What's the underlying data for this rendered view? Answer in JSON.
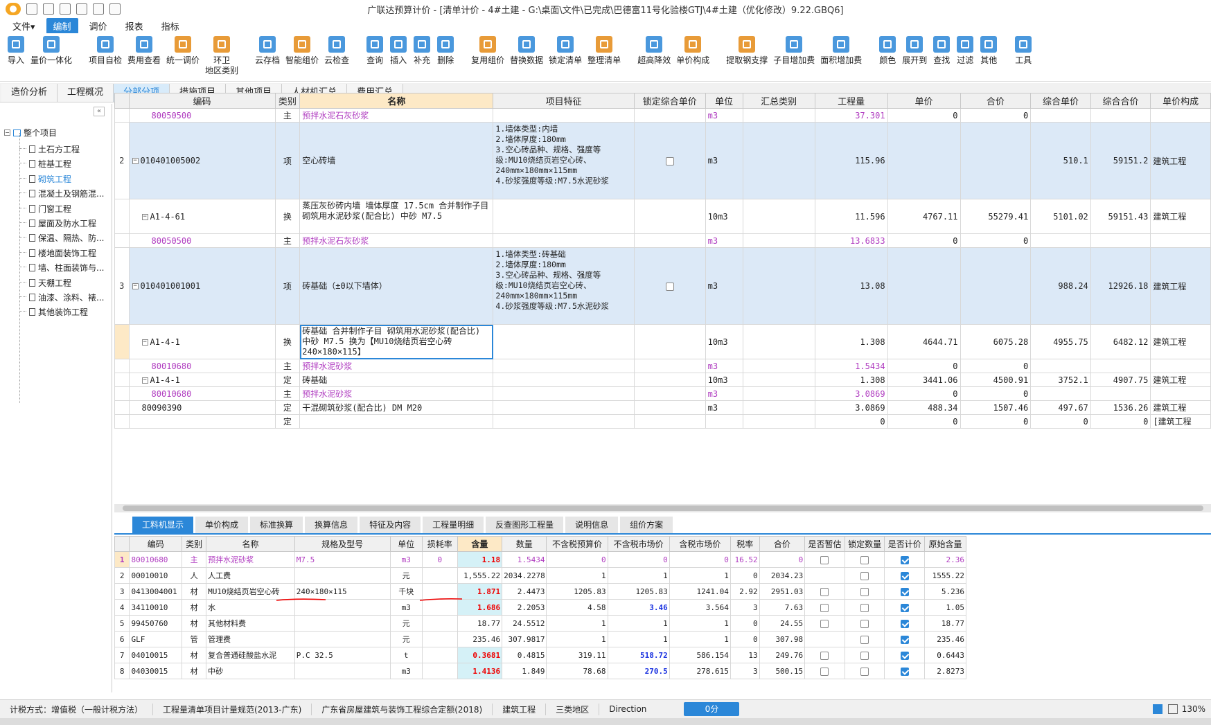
{
  "window": {
    "title": "广联达预算计价 - [清单计价 - 4#土建 - G:\\桌面\\文件\\已完成\\巴德富11号化验楼GTJ\\4#土建（优化修改）9.22.GBQ6]"
  },
  "menu": [
    "文件▾",
    "编制",
    "调价",
    "报表",
    "指标"
  ],
  "toolbar": [
    {
      "label": "导入",
      "icon": "import-icon",
      "color": "#2b87d8"
    },
    {
      "label": "量价一体化",
      "icon": "integration-icon",
      "color": "#2b87d8"
    },
    {
      "label": "项目自检",
      "icon": "self-check-icon",
      "color": "#2b87d8"
    },
    {
      "label": "费用查看",
      "icon": "fee-view-icon",
      "color": "#2b87d8"
    },
    {
      "label": "统一调价",
      "icon": "adjust-price-icon",
      "color": "#e58a16"
    },
    {
      "label": "环卫\n地区类别",
      "icon": "sanitation-icon",
      "color": "#e58a16"
    },
    {
      "label": "云存档",
      "icon": "cloud-save-icon",
      "color": "#2b87d8"
    },
    {
      "label": "智能组价",
      "icon": "smart-price-icon",
      "color": "#e58a16"
    },
    {
      "label": "云检查",
      "icon": "cloud-check-icon",
      "color": "#2b87d8"
    },
    {
      "label": "查询",
      "icon": "query-icon",
      "color": "#2b87d8"
    },
    {
      "label": "插入",
      "icon": "insert-icon",
      "color": "#2b87d8"
    },
    {
      "label": "补充",
      "icon": "supplement-icon",
      "color": "#2b87d8"
    },
    {
      "label": "删除",
      "icon": "delete-icon",
      "color": "#2b87d8"
    },
    {
      "label": "复用组价",
      "icon": "reuse-icon",
      "color": "#e58a16"
    },
    {
      "label": "替换数据",
      "icon": "replace-icon",
      "color": "#2b87d8"
    },
    {
      "label": "锁定清单",
      "icon": "lock-icon",
      "color": "#2b87d8"
    },
    {
      "label": "整理清单",
      "icon": "organize-icon",
      "color": "#e58a16"
    },
    {
      "label": "超高降效",
      "icon": "height-icon",
      "color": "#2b87d8"
    },
    {
      "label": "单价构成",
      "icon": "unit-price-icon",
      "color": "#e58a16"
    },
    {
      "label": "提取钢支撑",
      "icon": "steel-support-icon",
      "color": "#e58a16"
    },
    {
      "label": "子目增加费",
      "icon": "item-fee-icon",
      "color": "#2b87d8"
    },
    {
      "label": "面积增加费",
      "icon": "area-fee-icon",
      "color": "#2b87d8"
    },
    {
      "label": "颜色",
      "icon": "color-icon",
      "color": "#2b87d8"
    },
    {
      "label": "展开到",
      "icon": "expand-icon",
      "color": "#2b87d8"
    },
    {
      "label": "查找",
      "icon": "find-icon",
      "color": "#2b87d8"
    },
    {
      "label": "过滤",
      "icon": "filter-icon",
      "color": "#2b87d8"
    },
    {
      "label": "其他",
      "icon": "other-icon",
      "color": "#2b87d8"
    },
    {
      "label": "工具",
      "icon": "tools-icon",
      "color": "#2b87d8"
    }
  ],
  "tabs": [
    "造价分析",
    "工程概况",
    "分部分项",
    "措施项目",
    "其他项目",
    "人材机汇总",
    "费用汇总"
  ],
  "tree": {
    "root": "整个项目",
    "items": [
      "土石方工程",
      "桩基工程",
      "砌筑工程",
      "混凝土及钢筋混...",
      "门窗工程",
      "屋面及防水工程",
      "保温、隔热、防...",
      "楼地面装饰工程",
      "墙、柱面装饰与...",
      "天棚工程",
      "油漆、涂料、裱...",
      "其他装饰工程"
    ]
  },
  "grid": {
    "headers": [
      "",
      "编码",
      "类别",
      "名称",
      "项目特征",
      "锁定综合单价",
      "单位",
      "汇总类别",
      "工程量",
      "单价",
      "合价",
      "综合单价",
      "综合合价",
      "单价构成"
    ],
    "rows": [
      {
        "rn": "",
        "code": "80050500",
        "type": "主",
        "name": "预拌水泥石灰砂浆",
        "feature": "",
        "lock": "",
        "unit": "m3",
        "sum": "",
        "qty": "37.301",
        "price": "0",
        "total": "0",
        "cprice": "",
        "ctotal": "",
        "comp": "",
        "kind": "zhu",
        "indent": 2
      },
      {
        "rn": "2",
        "code": "010401005002",
        "type": "项",
        "name": "空心砖墙",
        "feature": "1.墙体类型:内墙\n2.墙体厚度:180mm\n3.空心砖品种、规格、强度等级:MU10烧结页岩空心砖、240mm×180mm×115mm\n4.砂浆强度等级:M7.5水泥砂浆",
        "lock": "box",
        "unit": "m3",
        "sum": "",
        "qty": "115.96",
        "price": "",
        "total": "",
        "cprice": "510.1",
        "ctotal": "59151.2",
        "comp": "建筑工程",
        "kind": "xiang",
        "indent": 0,
        "toggle": "−"
      },
      {
        "rn": "",
        "code": "A1-4-61",
        "type": "换",
        "name": "蒸压灰砂砖内墙 墙体厚度 17.5cm  合并制作子目 砌筑用水泥砂浆(配合比) 中砂 M7.5",
        "feature": "",
        "lock": "",
        "unit": "10m3",
        "sum": "",
        "qty": "11.596",
        "price": "4767.11",
        "total": "55279.41",
        "cprice": "5101.02",
        "ctotal": "59151.43",
        "comp": "建筑工程",
        "kind": "de",
        "indent": 1,
        "toggle": "−"
      },
      {
        "rn": "",
        "code": "80050500",
        "type": "主",
        "name": "预拌水泥石灰砂浆",
        "feature": "",
        "lock": "",
        "unit": "m3",
        "sum": "",
        "qty": "13.6833",
        "price": "0",
        "total": "0",
        "cprice": "",
        "ctotal": "",
        "comp": "",
        "kind": "zhu",
        "indent": 2
      },
      {
        "rn": "3",
        "code": "010401001001",
        "type": "项",
        "name": "砖基础（±0以下墙体）",
        "feature": "1.墙体类型:砖基础\n2.墙体厚度:180mm\n3.空心砖品种、规格、强度等级:MU10烧结页岩空心砖、240mm×180mm×115mm\n4.砂浆强度等级:M7.5水泥砂浆",
        "lock": "box",
        "unit": "m3",
        "sum": "",
        "qty": "13.08",
        "price": "",
        "total": "",
        "cprice": "988.24",
        "ctotal": "12926.18",
        "comp": "建筑工程",
        "kind": "xiang",
        "indent": 0,
        "toggle": "−"
      },
      {
        "rn": "",
        "code": "A1-4-1",
        "type": "换",
        "name": "砖基础  合并制作子目 砌筑用水泥砂浆(配合比) 中砂 M7.5  换为【MU10烧结页岩空心砖240×180×115】",
        "feature": "",
        "lock": "",
        "unit": "10m3",
        "sum": "",
        "qty": "1.308",
        "price": "4644.71",
        "total": "6075.28",
        "cprice": "4955.75",
        "ctotal": "6482.12",
        "comp": "建筑工程",
        "kind": "de-sel",
        "indent": 1,
        "toggle": "−"
      },
      {
        "rn": "",
        "code": "80010680",
        "type": "主",
        "name": "预拌水泥砂浆",
        "feature": "",
        "lock": "",
        "unit": "m3",
        "sum": "",
        "qty": "1.5434",
        "price": "0",
        "total": "0",
        "cprice": "",
        "ctotal": "",
        "comp": "",
        "kind": "zhu",
        "indent": 2
      },
      {
        "rn": "",
        "code": "A1-4-1",
        "type": "定",
        "name": "砖基础",
        "feature": "",
        "lock": "",
        "unit": "10m3",
        "sum": "",
        "qty": "1.308",
        "price": "3441.06",
        "total": "4500.91",
        "cprice": "3752.1",
        "ctotal": "4907.75",
        "comp": "建筑工程",
        "kind": "de",
        "indent": 1,
        "toggle": "−"
      },
      {
        "rn": "",
        "code": "80010680",
        "type": "主",
        "name": "预拌水泥砂浆",
        "feature": "",
        "lock": "",
        "unit": "m3",
        "sum": "",
        "qty": "3.0869",
        "price": "0",
        "total": "0",
        "cprice": "",
        "ctotal": "",
        "comp": "",
        "kind": "zhu",
        "indent": 2
      },
      {
        "rn": "",
        "code": "80090390",
        "type": "定",
        "name": "干混砌筑砂浆(配合比) DM M20",
        "feature": "",
        "lock": "",
        "unit": "m3",
        "sum": "",
        "qty": "3.0869",
        "price": "488.34",
        "total": "1507.46",
        "cprice": "497.67",
        "ctotal": "1536.26",
        "comp": "建筑工程",
        "kind": "de",
        "indent": 1
      },
      {
        "rn": "",
        "code": "",
        "type": "定",
        "name": "",
        "feature": "",
        "lock": "",
        "unit": "",
        "sum": "",
        "qty": "0",
        "price": "0",
        "total": "0",
        "cprice": "0",
        "ctotal": "0",
        "comp": "[建筑工程",
        "kind": "de",
        "indent": 1
      }
    ]
  },
  "bottom_tabs": [
    "工料机显示",
    "单价构成",
    "标准换算",
    "换算信息",
    "特征及内容",
    "工程量明细",
    "反查图形工程量",
    "说明信息",
    "组价方案"
  ],
  "sub": {
    "headers": [
      "",
      "编码",
      "类别",
      "名称",
      "规格及型号",
      "单位",
      "损耗率",
      "含量",
      "数量",
      "不含税预算价",
      "不含税市场价",
      "含税市场价",
      "税率",
      "合价",
      "是否暂估",
      "锁定数量",
      "是否计价",
      "原始含量"
    ],
    "rows": [
      {
        "rn": "1",
        "code": "80010680",
        "type": "主",
        "name": "预拌水泥砂浆",
        "spec": "M7.5",
        "unit": "m3",
        "loss": "0",
        "qty": "1.18",
        "count": "1.5434",
        "p1": "0",
        "p2": "0",
        "p3": "0",
        "tax": "16.52",
        "total": "0",
        "est": "box",
        "lockq": "box",
        "calc": "on",
        "orig": "2.36",
        "kind": "zhu",
        "red": true
      },
      {
        "rn": "2",
        "code": "00010010",
        "type": "人",
        "name": "人工费",
        "spec": "",
        "unit": "元",
        "loss": "",
        "qty": "1,555.22",
        "count": "2034.2278",
        "p1": "1",
        "p2": "1",
        "p3": "1",
        "tax": "0",
        "total": "2034.23",
        "est": "",
        "lockq": "box",
        "calc": "on",
        "orig": "1555.22",
        "kind": "",
        "red": false
      },
      {
        "rn": "3",
        "code": "0413004001",
        "type": "材",
        "name": "MU10烧结页岩空心砖",
        "spec": "240×180×115",
        "unit": "千块",
        "loss": "",
        "qty": "1.871",
        "count": "2.4473",
        "p1": "1205.83",
        "p2": "1205.83",
        "p3": "1241.04",
        "tax": "2.92",
        "total": "2951.03",
        "est": "box",
        "lockq": "box",
        "calc": "on",
        "orig": "5.236",
        "kind": "",
        "red": true
      },
      {
        "rn": "4",
        "code": "34110010",
        "type": "材",
        "name": "水",
        "spec": "",
        "unit": "m3",
        "loss": "",
        "qty": "1.686",
        "count": "2.2053",
        "p1": "4.58",
        "p2": "3.46",
        "p3": "3.564",
        "tax": "3",
        "total": "7.63",
        "est": "box",
        "lockq": "box",
        "calc": "on",
        "orig": "1.05",
        "kind": "",
        "red": true,
        "blue": true
      },
      {
        "rn": "5",
        "code": "99450760",
        "type": "材",
        "name": "其他材料费",
        "spec": "",
        "unit": "元",
        "loss": "",
        "qty": "18.77",
        "count": "24.5512",
        "p1": "1",
        "p2": "1",
        "p3": "1",
        "tax": "0",
        "total": "24.55",
        "est": "box",
        "lockq": "box",
        "calc": "on",
        "orig": "18.77",
        "kind": "",
        "red": false
      },
      {
        "rn": "6",
        "code": "GLF",
        "type": "管",
        "name": "管理费",
        "spec": "",
        "unit": "元",
        "loss": "",
        "qty": "235.46",
        "count": "307.9817",
        "p1": "1",
        "p2": "1",
        "p3": "1",
        "tax": "0",
        "total": "307.98",
        "est": "",
        "lockq": "box",
        "calc": "on",
        "orig": "235.46",
        "kind": "",
        "red": false
      },
      {
        "rn": "7",
        "code": "04010015",
        "type": "材",
        "name": "复合普通硅酸盐水泥",
        "spec": "P.C 32.5",
        "unit": "t",
        "loss": "",
        "qty": "0.3681",
        "count": "0.4815",
        "p1": "319.11",
        "p2": "518.72",
        "p3": "586.154",
        "tax": "13",
        "total": "249.76",
        "est": "box",
        "lockq": "box",
        "calc": "on",
        "orig": "0.6443",
        "kind": "",
        "red": true,
        "blue": true
      },
      {
        "rn": "8",
        "code": "04030015",
        "type": "材",
        "name": "中砂",
        "spec": "",
        "unit": "m3",
        "loss": "",
        "qty": "1.4136",
        "count": "1.849",
        "p1": "78.68",
        "p2": "270.5",
        "p3": "278.615",
        "tax": "3",
        "total": "500.15",
        "est": "box",
        "lockq": "box",
        "calc": "on",
        "orig": "2.8273",
        "kind": "",
        "red": true,
        "blue": true
      }
    ]
  },
  "status": {
    "tax_method": "计税方式：增值税（一般计税方法）",
    "spec": "工程量清单项目计量规范(2013-广东)",
    "quota": "广东省房屋建筑与装饰工程综合定额(2018)",
    "major": "建筑工程",
    "region": "三类地区",
    "direction": "Direction",
    "score": "0分",
    "zoom": "130%"
  }
}
